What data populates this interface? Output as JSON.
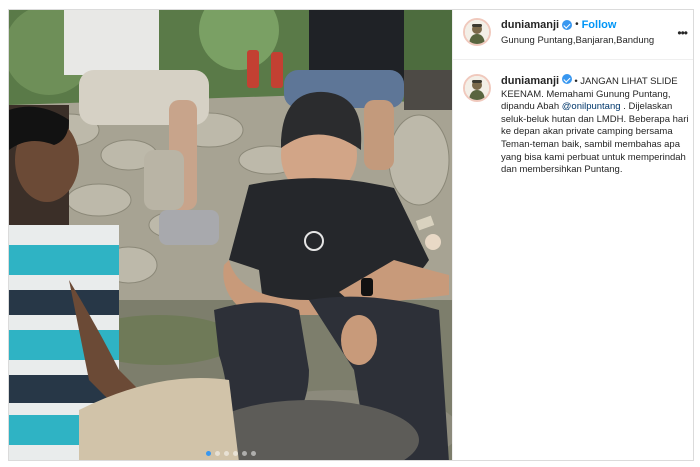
{
  "post": {
    "username": "dunia_manji",
    "username_display": "duniamanji",
    "verified": true,
    "separator": "•",
    "follow_label": "Follow",
    "location": "Gunung Puntang,Banjaran,Bandung",
    "more_label": "•••",
    "caption": {
      "username": "duniamanji",
      "part1": "• JANGAN LIHAT SLIDE KEENAM. Memahami Gunung Puntang, dipandu Abah ",
      "mention": "@onilpuntang",
      "part2": " . Dijelaskan seluk-beluk hutan dan LMDH. Beberapa hari ke depan akan private camping bersama Teman-teman baik, sambil membahas apa yang bisa kami perbuat untuk memperindah dan membersihkan Puntang."
    },
    "carousel": {
      "count": 6,
      "active_index": 0
    }
  },
  "colors": {
    "accent": "#0095f6",
    "verified_badge": "#3897f0",
    "mention": "#00376b",
    "text": "#262626",
    "border": "#dbdbdb"
  },
  "icons": [
    "avatar",
    "verified-badge-icon",
    "more-options-icon"
  ]
}
